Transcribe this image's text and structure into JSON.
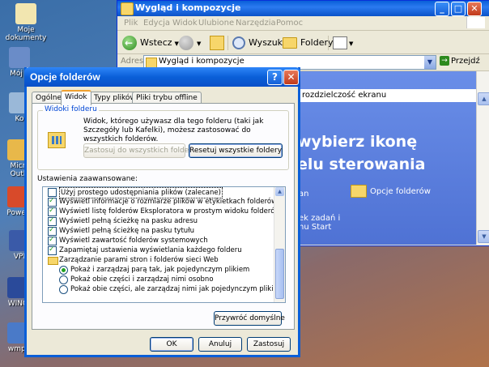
{
  "desktop": {
    "icons": [
      {
        "label": "Moje\ndokumenty",
        "color": "#f2e6b0"
      },
      {
        "label": "Mój k",
        "color": "#6a8cc8"
      },
      {
        "label": "Ko",
        "color": "#9ab8d8"
      },
      {
        "label": "Micr\nOutl",
        "color": "#e8b84a"
      },
      {
        "label": "Power",
        "color": "#d84a2a"
      },
      {
        "label": "VPI",
        "color": "#3a5aa8"
      },
      {
        "label": "WINC",
        "color": "#2a4a9a"
      },
      {
        "label": "wmpl",
        "color": "#4a7ac8"
      }
    ]
  },
  "explorer": {
    "title": "Wygląd i kompozycje",
    "menu": [
      "Plik",
      "Edycja",
      "Widok",
      "Ulubione",
      "Narzędzia",
      "Pomoc"
    ],
    "toolbar": {
      "back": "Wstecz",
      "search": "Wyszukaj",
      "folders": "Foldery"
    },
    "address": {
      "label": "Adres",
      "value": "Wygląd i kompozycje",
      "go": "Przejdź"
    },
    "content": {
      "header_text": "rozdzielczość ekranu",
      "heading_line1": "wybierz ikonę",
      "heading_line2": "elu sterowania",
      "task_a": "an",
      "task_b_line1": "ek zadań i",
      "task_b_line2": "nu Start",
      "folder_options": "Opcje folderów"
    }
  },
  "dialog": {
    "title": "Opcje folderów",
    "help": "?",
    "close": "✕",
    "tabs": [
      "Ogólne",
      "Widok",
      "Typy plików",
      "Pliki trybu offline"
    ],
    "active_tab": 1,
    "folder_views": {
      "legend": "Widoki folderu",
      "description": "Widok, którego używasz dla tego folderu (taki jak Szczegóły lub Kafelki), możesz zastosować do wszystkich folderów.",
      "apply_all": "Zastosuj do wszystkich folderów",
      "reset_all": "Resetuj wszystkie foldery"
    },
    "advanced_label": "Ustawienia zaawansowane:",
    "advanced_items": [
      {
        "type": "checkbox",
        "checked": false,
        "indent": 0,
        "label": "Użyj prostego udostępniania plików (zalecane)",
        "selected": true
      },
      {
        "type": "checkbox",
        "checked": true,
        "indent": 0,
        "label": "Wyświetl informacje o rozmiarze plików w etykietkach folderów"
      },
      {
        "type": "checkbox",
        "checked": true,
        "indent": 0,
        "label": "Wyświetl listę folderów Eksploratora w prostym widoku folderów"
      },
      {
        "type": "checkbox",
        "checked": true,
        "indent": 0,
        "label": "Wyświetl pełną ścieżkę na pasku adresu"
      },
      {
        "type": "checkbox",
        "checked": true,
        "indent": 0,
        "label": "Wyświetl pełną ścieżkę na pasku tytułu"
      },
      {
        "type": "checkbox",
        "checked": true,
        "indent": 0,
        "label": "Wyświetl zawartość folderów systemowych"
      },
      {
        "type": "checkbox",
        "checked": true,
        "indent": 0,
        "label": "Zapamiętaj ustawienia wyświetlania każdego folderu"
      },
      {
        "type": "folder",
        "indent": 0,
        "label": "Zarządzanie parami stron i folderów sieci Web"
      },
      {
        "type": "radio",
        "checked": true,
        "indent": 1,
        "label": "Pokaż i zarządzaj parą tak, jak pojedynczym plikiem"
      },
      {
        "type": "radio",
        "checked": false,
        "indent": 1,
        "label": "Pokaż obie części i zarządzaj nimi osobno"
      },
      {
        "type": "radio",
        "checked": false,
        "indent": 1,
        "label": "Pokaż obie części, ale zarządzaj nimi jak pojedynczym plikiem"
      }
    ],
    "restore_defaults": "Przywróć domyślne",
    "buttons": {
      "ok": "OK",
      "cancel": "Anuluj",
      "apply": "Zastosuj"
    }
  }
}
